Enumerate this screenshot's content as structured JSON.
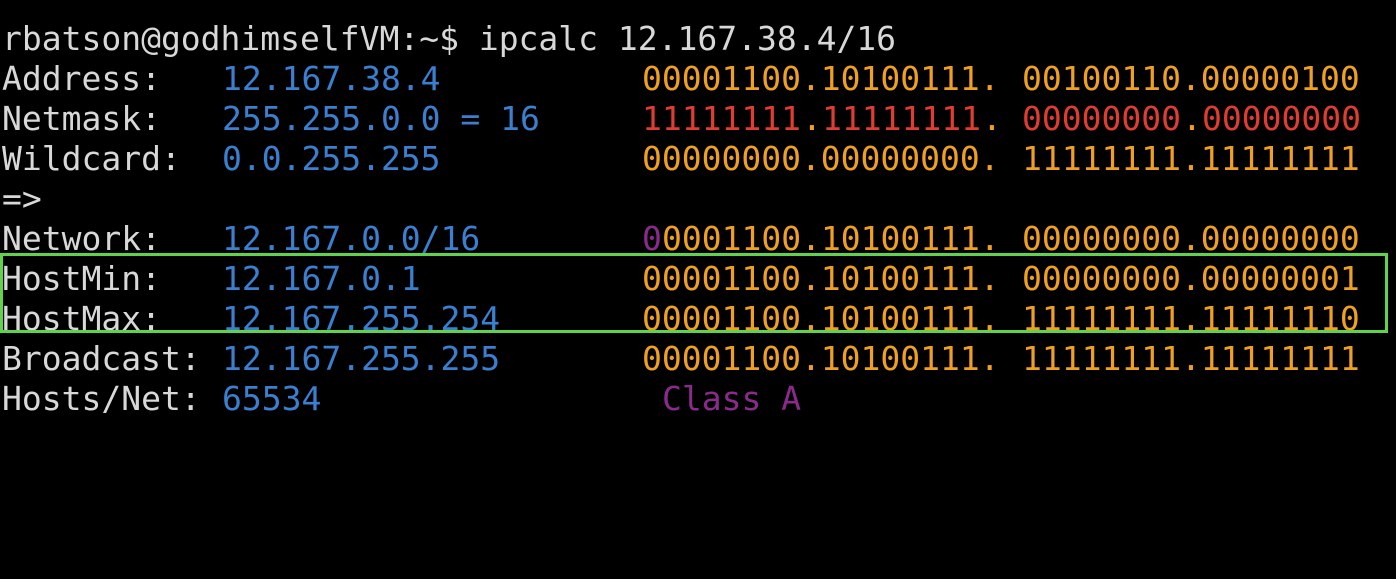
{
  "prompt": {
    "text": "rbatson@godhimselfVM:~$ ipcalc 12.167.38.4/16"
  },
  "rows": {
    "address": {
      "label": "Address:",
      "value": "12.167.38.4",
      "bin_net": "00001100.10100111.",
      "bin_host": "00100110.00000100"
    },
    "netmask": {
      "label": "Netmask:",
      "value": "255.255.0.0 = 16",
      "bin_net_a": "11111111",
      "bin_dot_a": ".",
      "bin_net_b": "11111111",
      "bin_dot_b": ".",
      "bin_host_a": "00000000",
      "bin_dot_c": ".",
      "bin_host_b": "00000000"
    },
    "wildcard": {
      "label": "Wildcard:",
      "value": "0.0.255.255",
      "bin_net": "00000000.00000000.",
      "bin_host": "11111111.11111111"
    },
    "arrow": {
      "label": "=>"
    },
    "network": {
      "label": "Network:",
      "value": "12.167.0.0/16",
      "bin_first": "0",
      "bin_net": "0001100.10100111.",
      "bin_host": "00000000.00000000"
    },
    "hostmin": {
      "label": "HostMin:",
      "value": "12.167.0.1",
      "bin_net": "00001100.10100111.",
      "bin_host": "00000000.00000001"
    },
    "hostmax": {
      "label": "HostMax:",
      "value": "12.167.255.254",
      "bin_net": "00001100.10100111.",
      "bin_host": "11111111.11111110"
    },
    "broadcast": {
      "label": "Broadcast:",
      "value": "12.167.255.255",
      "bin_net": "00001100.10100111.",
      "bin_host": "11111111.11111111"
    },
    "hosts": {
      "label": "Hosts/Net:",
      "value": "65534",
      "class": "Class A"
    }
  },
  "colors": {
    "background": "#000000",
    "text": "#d8d8d8",
    "value": "#3a7fd0",
    "binary": "#f0a020",
    "netmask_binary": "#e03c31",
    "class": "#8a2a8a",
    "highlight": "#5fd34a"
  }
}
